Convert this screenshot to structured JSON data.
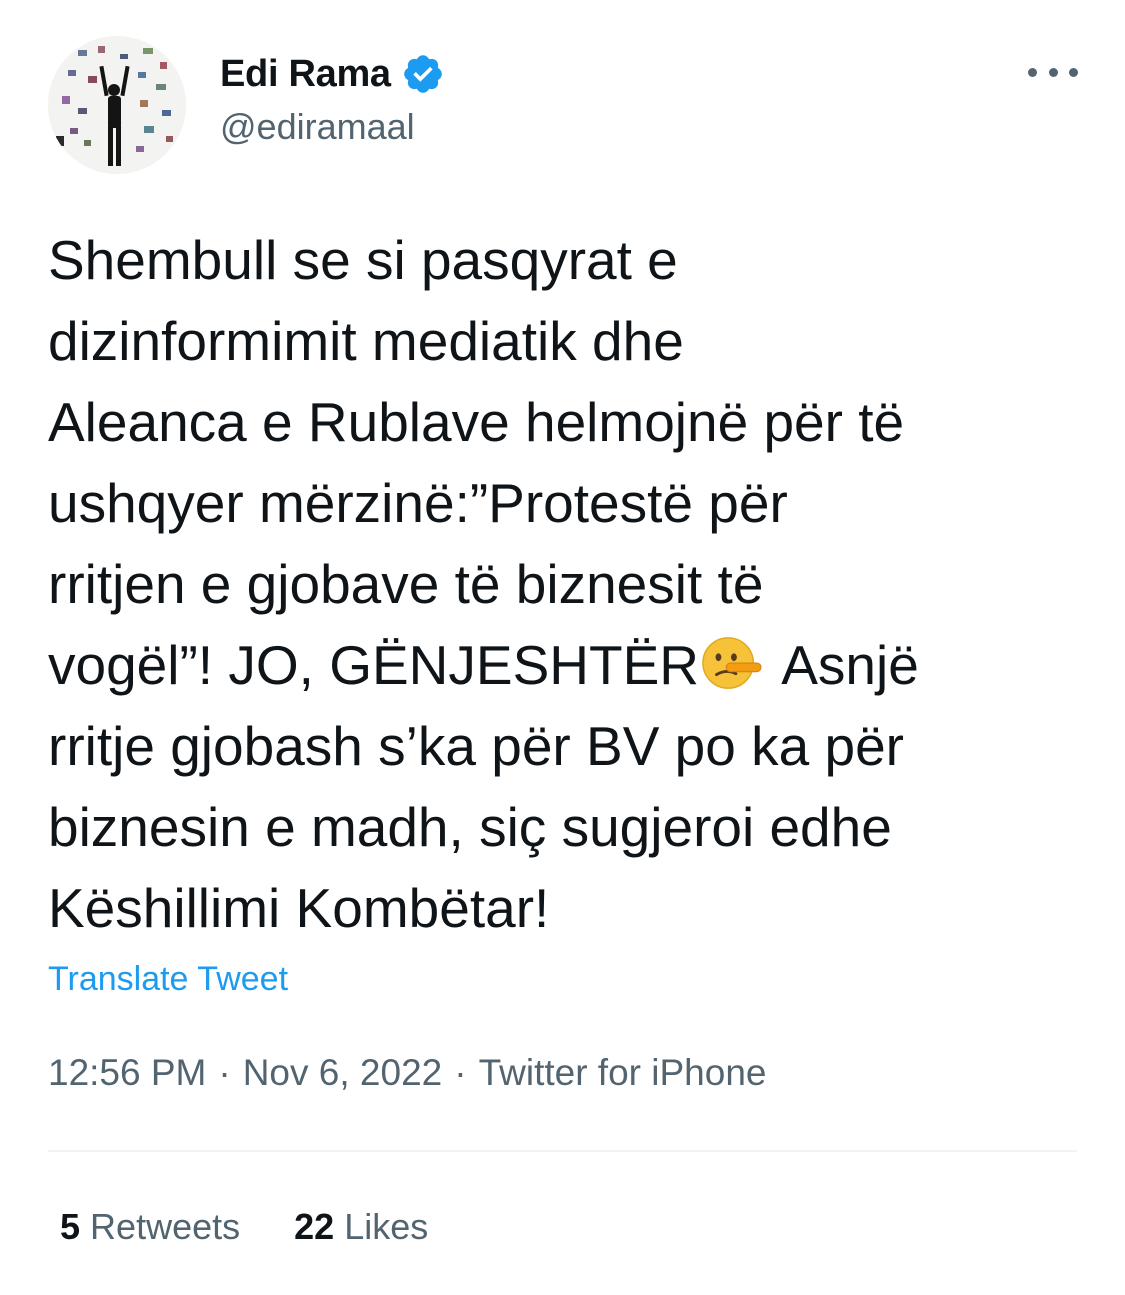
{
  "author": {
    "name": "Edi Rama",
    "handle": "@ediramaal",
    "verified_icon": "verified-badge-icon",
    "verified_color": "#1d9bf0"
  },
  "menu_icon": "more-dots-icon",
  "tweet": {
    "lines": [
      "Shembull se si pasqyrat e",
      "dizinformimit mediatik dhe",
      "Aleanca e Rublave helmojnë për të",
      "ushqyer mërzinë:”Protestë për",
      "rritjen e gjobave të biznesit të"
    ],
    "line6_before_emoji": "vogël”! JO, GËNJESHTËR",
    "emoji": "lying-face-emoji",
    "line6_after_emoji": " Asnjë",
    "lines_after": [
      "rritje gjobash s’ka për BV po ka për",
      "biznesin e madh, siç sugjeroi edhe",
      "Këshillimi Kombëtar!"
    ]
  },
  "translate_label": "Translate Tweet",
  "meta": {
    "time": "12:56 PM",
    "date": "Nov 6, 2022",
    "source": "Twitter for iPhone",
    "separator": "·"
  },
  "stats": {
    "retweets_count": "5",
    "retweets_label": "Retweets",
    "likes_count": "22",
    "likes_label": "Likes"
  },
  "colors": {
    "link": "#1d9bf0",
    "secondary_text": "#536471",
    "primary_text": "#0f1419"
  }
}
